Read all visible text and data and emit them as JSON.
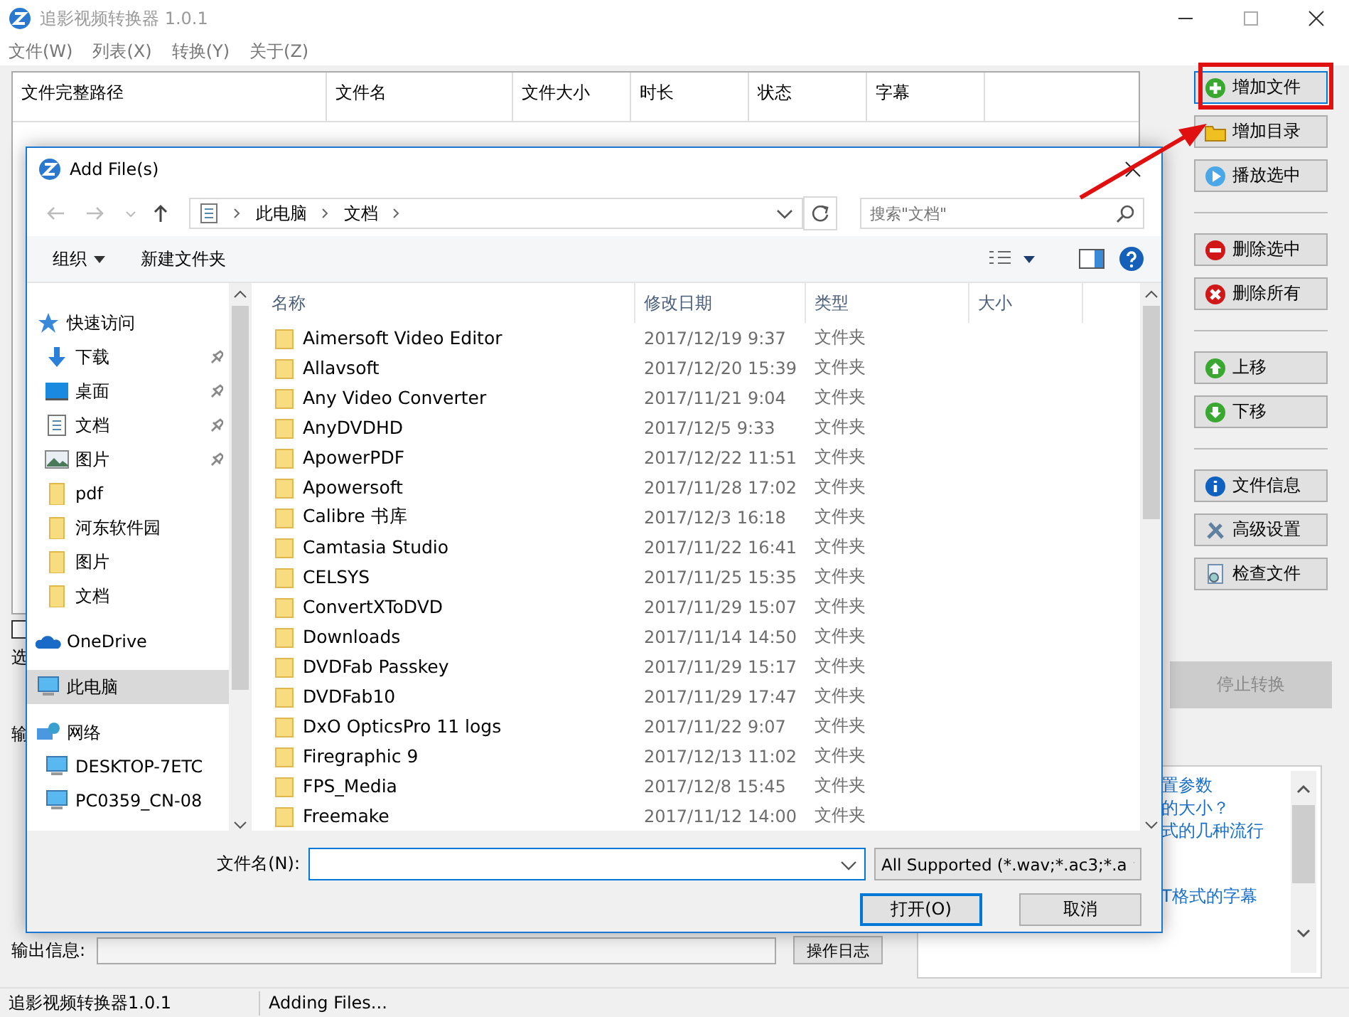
{
  "window": {
    "title": "追影视频转换器 1.0.1"
  },
  "menu": [
    "文件(W)",
    "列表(X)",
    "转换(Y)",
    "关于(Z)"
  ],
  "table": {
    "columns": [
      "文件完整路径",
      "文件名",
      "文件大小",
      "时长",
      "状态",
      "字幕"
    ]
  },
  "side_buttons": [
    [
      {
        "label": "增加文件",
        "kind": "add",
        "highlighted": true
      },
      {
        "label": "增加目录",
        "kind": "folder",
        "highlighted": false
      },
      {
        "label": "播放选中",
        "kind": "play",
        "highlighted": false
      }
    ],
    [
      {
        "label": "删除选中",
        "kind": "remove",
        "highlighted": false
      },
      {
        "label": "删除所有",
        "kind": "clear",
        "highlighted": false
      }
    ],
    [
      {
        "label": "上移",
        "kind": "up",
        "highlighted": false
      },
      {
        "label": "下移",
        "kind": "down",
        "highlighted": false
      }
    ],
    [
      {
        "label": "文件信息",
        "kind": "info",
        "highlighted": false
      },
      {
        "label": "高级设置",
        "kind": "tools",
        "highlighted": false
      },
      {
        "label": "检查文件",
        "kind": "inspect",
        "highlighted": false
      }
    ]
  ],
  "option_checkbox": {
    "checked": false
  },
  "label_fragments": [
    "选",
    "输"
  ],
  "stop_button": {
    "label": "停止转换",
    "disabled": true
  },
  "output_info": {
    "label": "输出信息:",
    "log_button": "操作日志"
  },
  "help_links": [
    "置参数",
    "的大小？",
    "式的几种流行",
    "T格式的字幕"
  ],
  "status_bar": [
    "追影视频转换器1.0.1",
    "Adding Files..."
  ],
  "dialog": {
    "title": "Add File(s)",
    "path": [
      "此电脑",
      "文档"
    ],
    "search": {
      "placeholder": "搜索\"文档\""
    },
    "toolbar": [
      "组织",
      "新建文件夹"
    ],
    "nav": [
      {
        "label": "快速访问",
        "kind": "star",
        "selected": false,
        "children": [
          {
            "label": "下载",
            "kind": "download",
            "pinned": true,
            "selected": false
          },
          {
            "label": "桌面",
            "kind": "desktop",
            "pinned": true,
            "selected": false
          },
          {
            "label": "文档",
            "kind": "document",
            "pinned": true,
            "selected": false
          },
          {
            "label": "图片",
            "kind": "pictures",
            "pinned": true,
            "selected": false
          },
          {
            "label": "pdf",
            "kind": "folder",
            "pinned": false,
            "selected": false
          },
          {
            "label": "河东软件园",
            "kind": "folder",
            "pinned": false,
            "selected": false
          },
          {
            "label": "图片",
            "kind": "folder",
            "pinned": false,
            "selected": false
          },
          {
            "label": "文档",
            "kind": "folder",
            "pinned": false,
            "selected": false
          }
        ]
      },
      {
        "label": "OneDrive",
        "kind": "cloud",
        "selected": false
      },
      {
        "label": "此电脑",
        "kind": "computer",
        "selected": true
      },
      {
        "label": "网络",
        "kind": "network",
        "selected": false,
        "children": [
          {
            "label": "DESKTOP-7ETC",
            "kind": "computer",
            "pinned": false,
            "selected": false
          },
          {
            "label": "PC0359_CN-08",
            "kind": "computer",
            "pinned": false,
            "selected": false
          }
        ]
      }
    ],
    "columns": [
      "名称",
      "修改日期",
      "类型",
      "大小"
    ],
    "files": [
      {
        "name": "Aimersoft Video Editor",
        "date": "2017/12/19 9:37",
        "type": "文件夹"
      },
      {
        "name": "Allavsoft",
        "date": "2017/12/20 15:39",
        "type": "文件夹"
      },
      {
        "name": "Any Video Converter",
        "date": "2017/11/21 9:04",
        "type": "文件夹"
      },
      {
        "name": "AnyDVDHD",
        "date": "2017/12/5 9:33",
        "type": "文件夹"
      },
      {
        "name": "ApowerPDF",
        "date": "2017/12/22 11:51",
        "type": "文件夹"
      },
      {
        "name": "Apowersoft",
        "date": "2017/11/28 17:02",
        "type": "文件夹"
      },
      {
        "name": "Calibre 书库",
        "date": "2017/12/3 16:18",
        "type": "文件夹"
      },
      {
        "name": "Camtasia Studio",
        "date": "2017/11/22 16:41",
        "type": "文件夹"
      },
      {
        "name": "CELSYS",
        "date": "2017/11/25 15:35",
        "type": "文件夹"
      },
      {
        "name": "ConvertXToDVD",
        "date": "2017/11/29 15:07",
        "type": "文件夹"
      },
      {
        "name": "Downloads",
        "date": "2017/11/14 14:50",
        "type": "文件夹"
      },
      {
        "name": "DVDFab Passkey",
        "date": "2017/11/29 15:17",
        "type": "文件夹"
      },
      {
        "name": "DVDFab10",
        "date": "2017/11/29 17:47",
        "type": "文件夹"
      },
      {
        "name": "DxO OpticsPro 11 logs",
        "date": "2017/11/22 9:07",
        "type": "文件夹"
      },
      {
        "name": "Firegraphic 9",
        "date": "2017/12/13 11:02",
        "type": "文件夹"
      },
      {
        "name": "FPS_Media",
        "date": "2017/12/8 15:45",
        "type": "文件夹"
      },
      {
        "name": "Freemake",
        "date": "2017/11/12 14:00",
        "type": "文件夹"
      }
    ],
    "filename": {
      "label": "文件名(N):"
    },
    "filter": "All Supported (*.wav;*.ac3;*.a",
    "buttons": [
      {
        "label": "打开(O)",
        "default": true
      },
      {
        "label": "取消",
        "default": false
      }
    ]
  }
}
